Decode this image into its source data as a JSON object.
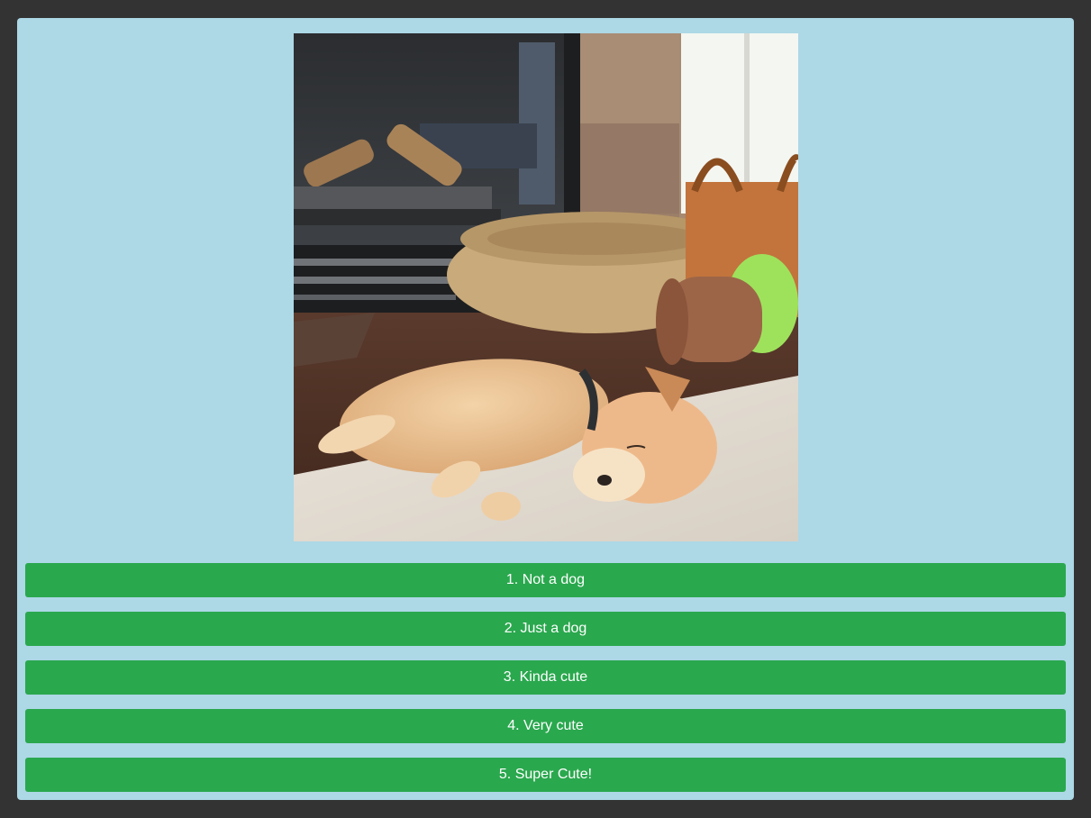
{
  "photo": {
    "subject": "puppy-sleeping-on-rug-near-fireplace"
  },
  "choices": [
    {
      "label": "1. Not a dog"
    },
    {
      "label": "2. Just a dog"
    },
    {
      "label": "3. Kinda cute"
    },
    {
      "label": "4. Very cute"
    },
    {
      "label": "5. Super Cute!"
    }
  ],
  "colors": {
    "page_background": "#333333",
    "panel_background": "#add8e6",
    "button_background": "#2aa84e",
    "button_text": "#ffffff"
  }
}
